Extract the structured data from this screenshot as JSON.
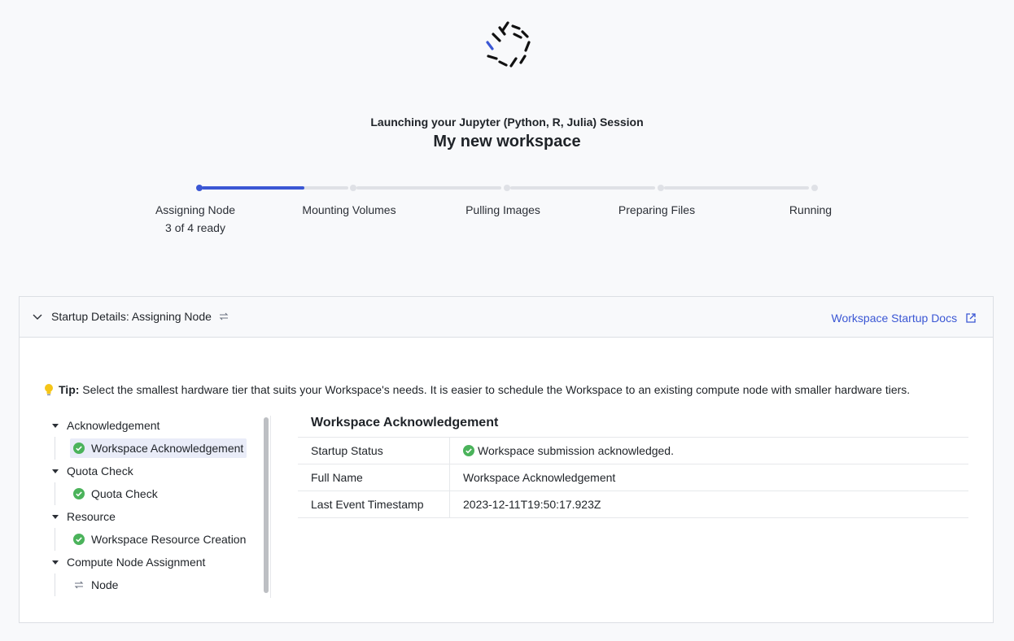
{
  "session_label": "Launching your Jupyter (Python, R, Julia) Session",
  "workspace_name": "My new workspace",
  "progress": {
    "active_step": 1,
    "active_fraction": 0.7,
    "steps": [
      {
        "label": "Assigning Node",
        "sub": "3 of 4 ready"
      },
      {
        "label": "Mounting Volumes"
      },
      {
        "label": "Pulling Images"
      },
      {
        "label": "Preparing Files"
      },
      {
        "label": "Running"
      }
    ]
  },
  "panel": {
    "title": "Startup Details: Assigning Node",
    "docs_link": "Workspace Startup Docs"
  },
  "tip": {
    "label": "Tip:",
    "text": "Select the smallest hardware tier that suits your Workspace's needs. It is easier to schedule the Workspace to an existing compute node with smaller hardware tiers."
  },
  "tree": [
    {
      "group": "Acknowledgement",
      "child": "Workspace Acknowledgement",
      "status": "ok",
      "selected": true
    },
    {
      "group": "Quota Check",
      "child": "Quota Check",
      "status": "ok"
    },
    {
      "group": "Resource",
      "child": "Workspace Resource Creation",
      "status": "ok"
    },
    {
      "group": "Compute Node Assignment",
      "child": "Node",
      "status": "pending"
    }
  ],
  "detail": {
    "title": "Workspace Acknowledgement",
    "rows": [
      {
        "key": "Startup Status",
        "value": "Workspace submission acknowledged.",
        "status": "ok"
      },
      {
        "key": "Full Name",
        "value": "Workspace Acknowledgement"
      },
      {
        "key": "Last Event Timestamp",
        "value": "2023-12-11T19:50:17.923Z"
      }
    ]
  },
  "colors": {
    "accent": "#3b57d4",
    "success": "#4bb35b",
    "tip_bulb": "#f5c518"
  },
  "icons": {
    "spinner": "loading-spinner-icon",
    "chevron": "chevron-down-icon",
    "refresh": "sync-icon",
    "external": "external-link-icon",
    "bulb": "lightbulb-icon",
    "ok": "check-circle-icon",
    "pending": "sync-icon"
  }
}
